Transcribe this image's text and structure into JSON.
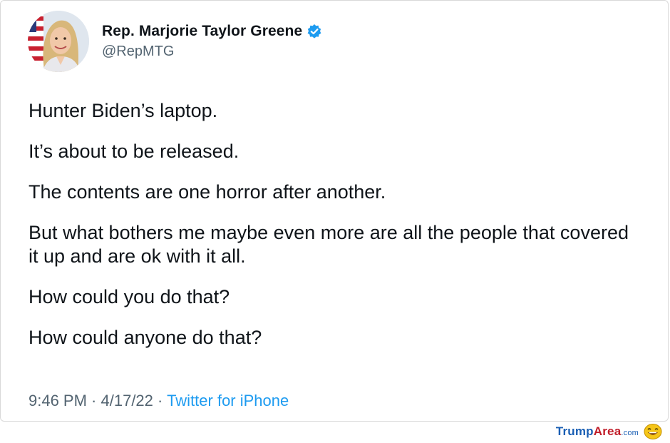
{
  "tweet": {
    "display_name": "Rep. Marjorie Taylor Greene",
    "handle": "@RepMTG",
    "paragraphs": [
      "Hunter Biden’s laptop.",
      "It’s about to be released.",
      "The contents are one horror after another.",
      "But what bothers me maybe even more are all the people that covered it up and are ok with it all.",
      "How could you do that?",
      "How could anyone do that?"
    ],
    "time": "9:46 PM",
    "separator": " · ",
    "date": "4/17/22",
    "source": "Twitter for iPhone",
    "more_label": "...",
    "verified_color": "#1d9bf0"
  },
  "watermark": {
    "part1": "Trump",
    "part2": "Area",
    "part3": ".com"
  },
  "icons": {
    "verified": "verified-badge-icon",
    "more": "more-options-icon",
    "emoji": "laughing-face-icon"
  }
}
